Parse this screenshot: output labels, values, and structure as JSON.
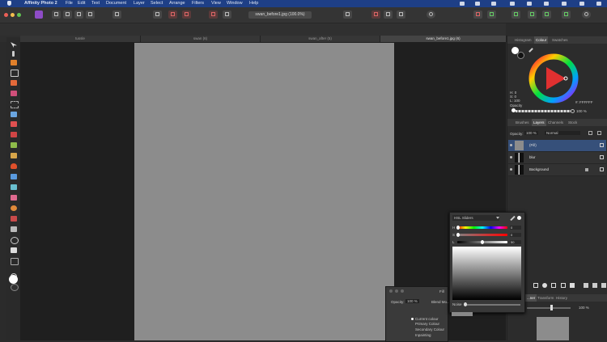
{
  "menubar": {
    "app": "Affinity Photo 2",
    "items": [
      "File",
      "Edit",
      "Text",
      "Document",
      "Layer",
      "Select",
      "Arrange",
      "Filters",
      "View",
      "Window",
      "Help"
    ]
  },
  "toolbar": {
    "document_title": "swan_before1.jpg (100.0%)"
  },
  "tabs": [
    "tussle",
    "swan (6)",
    "swan_after (5)",
    "swan_before1.jpg (6)"
  ],
  "right_panel": {
    "top_tabs": [
      "Histogram",
      "Colour",
      "Swatches"
    ],
    "color_readout": {
      "h": "H: 0",
      "s": "S: 0",
      "l": "L: 100"
    },
    "opacity_label": "Opacity",
    "opacity_value": "100 %",
    "hex": "#: FFFFFF",
    "layer_tabs": [
      "Brushes",
      "Layers",
      "Channels",
      "Stock"
    ],
    "layers_opacity_label": "Opacity:",
    "layers_opacity_value": "100 %",
    "blend_mode": "Normal",
    "layers": [
      "(Fill)",
      "blur",
      "Background"
    ],
    "bottom_tabs": [
      "...ner",
      "Transform",
      "History"
    ],
    "bottom_value": "100 %"
  },
  "hsl_popup": {
    "mode": "HSL Sliders",
    "labels": [
      "H",
      "S",
      "L"
    ],
    "values": [
      "0",
      "0",
      "50"
    ],
    "noise_label": "Noise"
  },
  "fill_dialog": {
    "title": "Fill",
    "opacity_label": "Opacity:",
    "opacity_value": "100 %",
    "blend_label": "Blend Mo...",
    "options": [
      "Current colour",
      "Primary Colour",
      "Secondary Colour",
      "Inpainting"
    ]
  },
  "colors": {
    "accent": "#1e3f86",
    "selection": "#36507a",
    "canvas": "#8c8c8c"
  }
}
